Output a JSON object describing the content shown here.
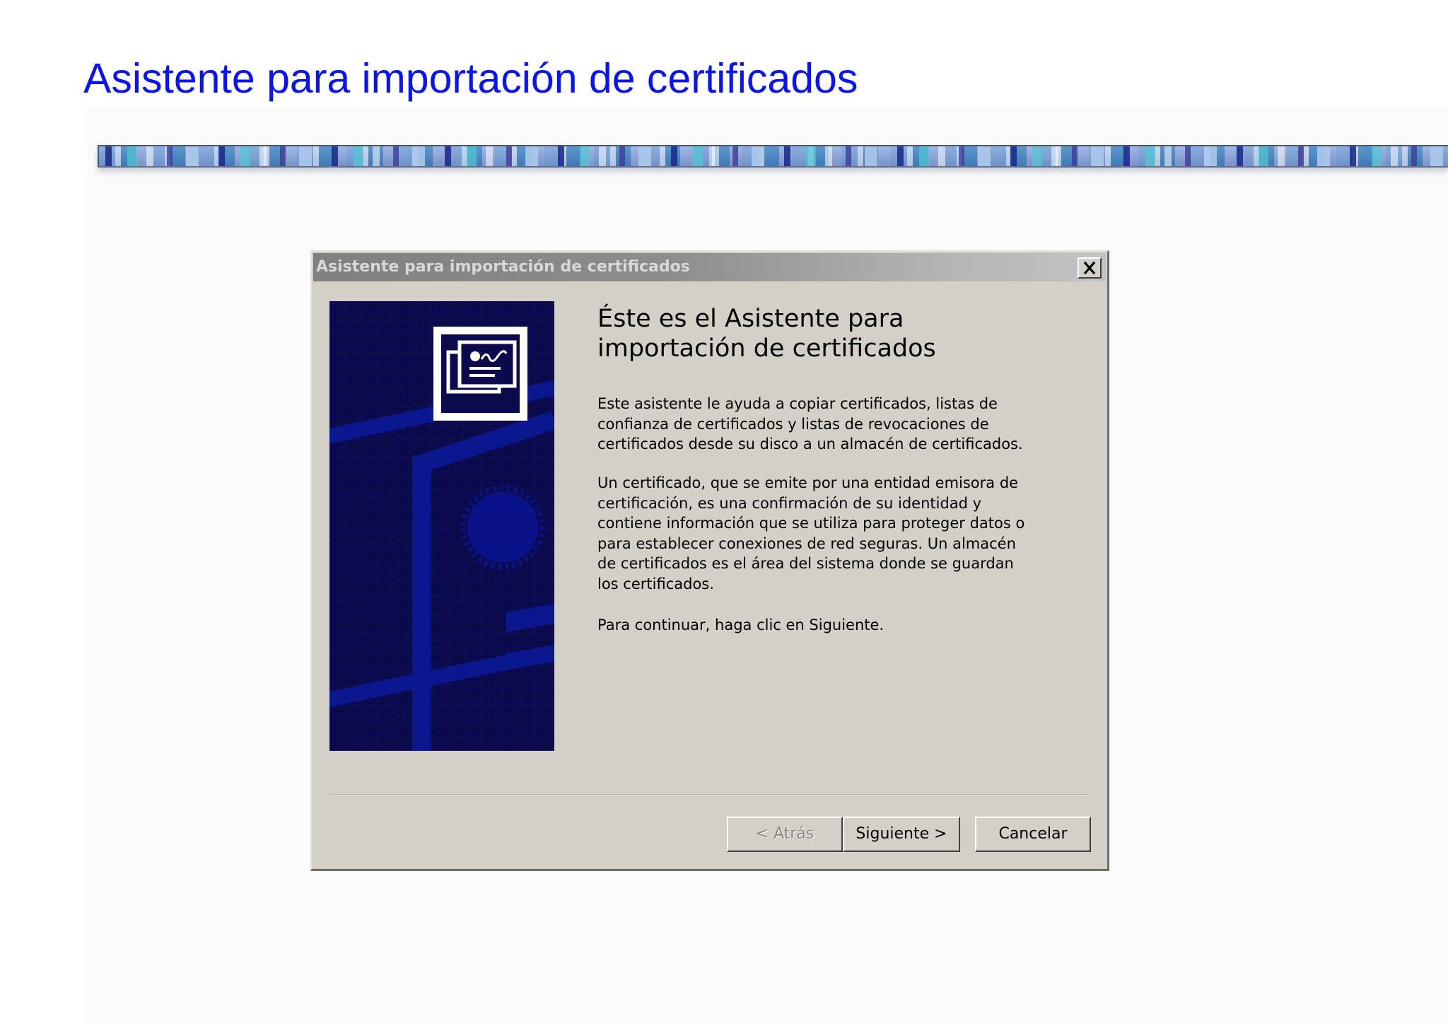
{
  "slide": {
    "title": "Asistente para importación de certificados"
  },
  "dialog": {
    "title": "Asistente para importación de certificados",
    "heading_lines": [
      "Éste es el Asistente para",
      "importación de certificados"
    ],
    "paragraph1_lines": [
      "Este asistente le ayuda a copiar certificados, listas de",
      "confianza de certificados y listas de revocaciones de",
      "certificados desde su disco a un almacén de certificados."
    ],
    "paragraph2_lines": [
      "Un certificado, que se emite por una entidad emisora de",
      "certificación, es una confirmación de su identidad y",
      "contiene información que se utiliza para proteger datos o",
      "para establecer conexiones de red seguras. Un almacén",
      "de certificados es el área del sistema donde se guardan",
      "los certificados."
    ],
    "paragraph3_lines": [
      "Para continuar, haga clic en Siguiente."
    ],
    "buttons": {
      "back": "< Atrás",
      "back_enabled": false,
      "next": "Siguiente >",
      "cancel": "Cancelar"
    },
    "icons": {
      "close": "close-icon",
      "certificate": "certificate-icon"
    }
  },
  "colors": {
    "slide_title": "#0a14f2",
    "dialog_face": "#d4d0c8",
    "titlebar_inactive": "#808080",
    "side_panel_navy": "#0a0a4a",
    "side_panel_accent": "#0a1690"
  }
}
